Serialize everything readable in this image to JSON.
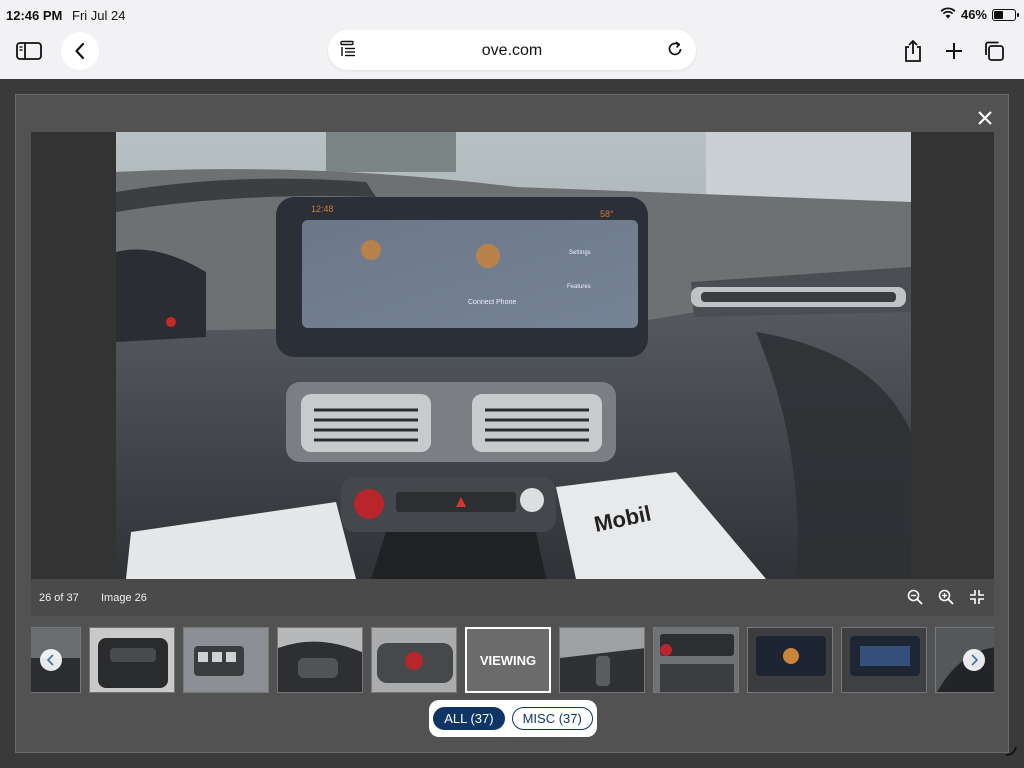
{
  "status": {
    "time": "12:46 PM",
    "date": "Fri Jul 24",
    "battery": "46%",
    "battery_level": 0.46
  },
  "browser": {
    "url": "ove.com"
  },
  "viewer": {
    "counter": "26 of 37",
    "image_label": "Image 26",
    "viewing_label": "VIEWING",
    "photo_texts": {
      "screen_time": "12:48",
      "temp": "58°",
      "connect_phone": "Connect Phone",
      "settings": "Settings",
      "features": "Features",
      "mobil": "Mobil"
    },
    "filters": [
      {
        "label": "ALL (37)"
      },
      {
        "label": "MISC (37)"
      }
    ]
  },
  "colors": {
    "accent": "#0f3566",
    "modal_bg": "#525252"
  }
}
